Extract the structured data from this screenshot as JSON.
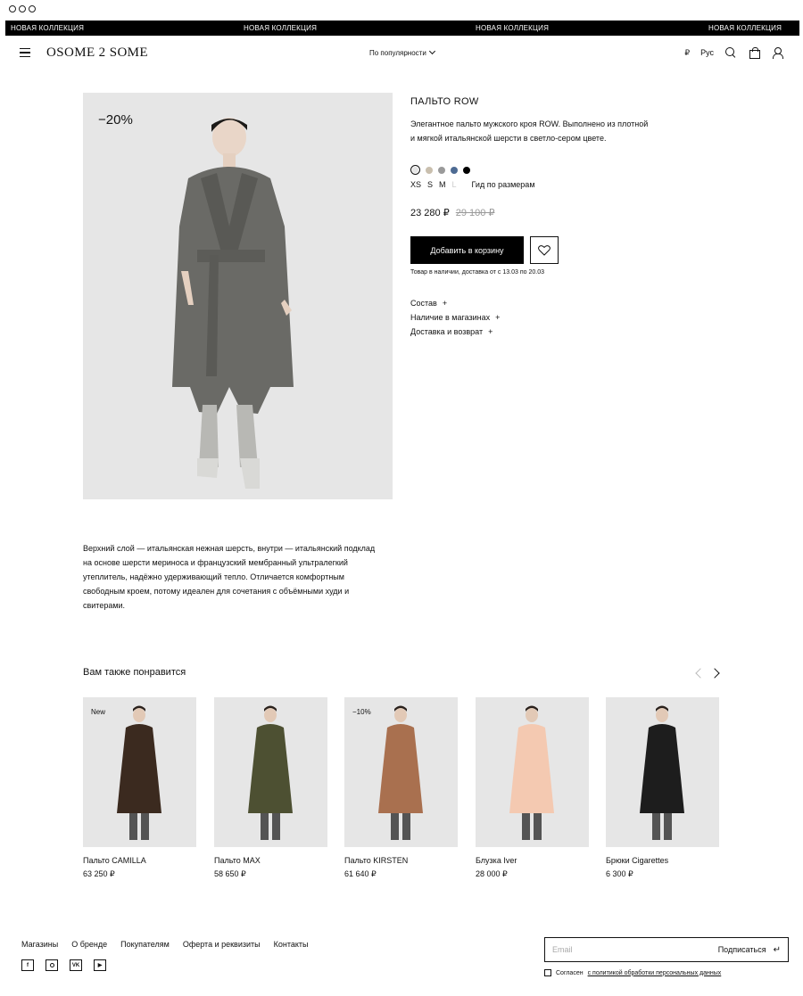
{
  "ticker": [
    "НОВАЯ КОЛЛЕКЦИЯ",
    "НОВАЯ КОЛЛЕКЦИЯ",
    "НОВАЯ КОЛЛЕКЦИЯ",
    "НОВАЯ КОЛЛЕКЦИЯ"
  ],
  "header": {
    "logo": "OSOME 2 SOME",
    "sort": "По популярности",
    "currency": "₽",
    "language": "Рус"
  },
  "product": {
    "discount_badge": "−20%",
    "title": "ПАЛЬТО ROW",
    "description": "Элегантное пальто мужского кроя ROW. Выполнено из плотной и мягкой итальянской шерсти в светло-сером цвете.",
    "colors": [
      "#e6e6e6",
      "#c9bfae",
      "#9a9a9a",
      "#4e6b93",
      "#000000"
    ],
    "sizes": [
      {
        "label": "XS",
        "available": true
      },
      {
        "label": "S",
        "available": true
      },
      {
        "label": "M",
        "available": true
      },
      {
        "label": "L",
        "available": false
      }
    ],
    "size_guide": "Гид по размерам",
    "price": "23 280 ₽",
    "old_price": "29 100 ₽",
    "add_to_cart": "Добавить в корзину",
    "availability": "Товар в наличии, доставка от с 13.03 по 20.03",
    "accordion": [
      "Состав",
      "Наличие в магазинах",
      "Доставка и возврат"
    ],
    "long_description": "Верхний слой — итальянская нежная шерсть, внутри — итальянский подклад на основе шерсти мериноса и французский мембранный ультралегкий утеплитель, надёжно удерживающий тепло. Отличается комфортным свободным кроем, потому идеален для сочетания с объёмными худи и свитерами."
  },
  "recommendations": {
    "title": "Вам также понравится",
    "items": [
      {
        "tag": "New",
        "name": "Пальто CAMILLA",
        "price": "63  250 ₽",
        "garment": "#3b2a1f"
      },
      {
        "tag": "",
        "name": "Пальто MAX",
        "price": "58 650 ₽",
        "garment": "#4d5032"
      },
      {
        "tag": "−10%",
        "name": "Пальто KIRSTEN",
        "price": "61 640 ₽",
        "garment": "#a9704f"
      },
      {
        "tag": "",
        "name": "Блузка Iver",
        "price": "28 000 ₽",
        "garment": "#f4c9b1"
      },
      {
        "tag": "",
        "name": "Брюки Cigarettes",
        "price": "6 300 ₽",
        "garment": "#1d1d1d"
      }
    ]
  },
  "footer": {
    "links": [
      "Магазины",
      "О бренде",
      "Покупателям",
      "Оферта и реквизиты",
      "Контакты"
    ],
    "socials": [
      "f",
      "ig",
      "VK",
      "▶"
    ],
    "email_placeholder": "Email",
    "subscribe": "Подписаться",
    "consent_prefix": "Согласен",
    "consent_link": "с политикой обработки персональных данных"
  }
}
